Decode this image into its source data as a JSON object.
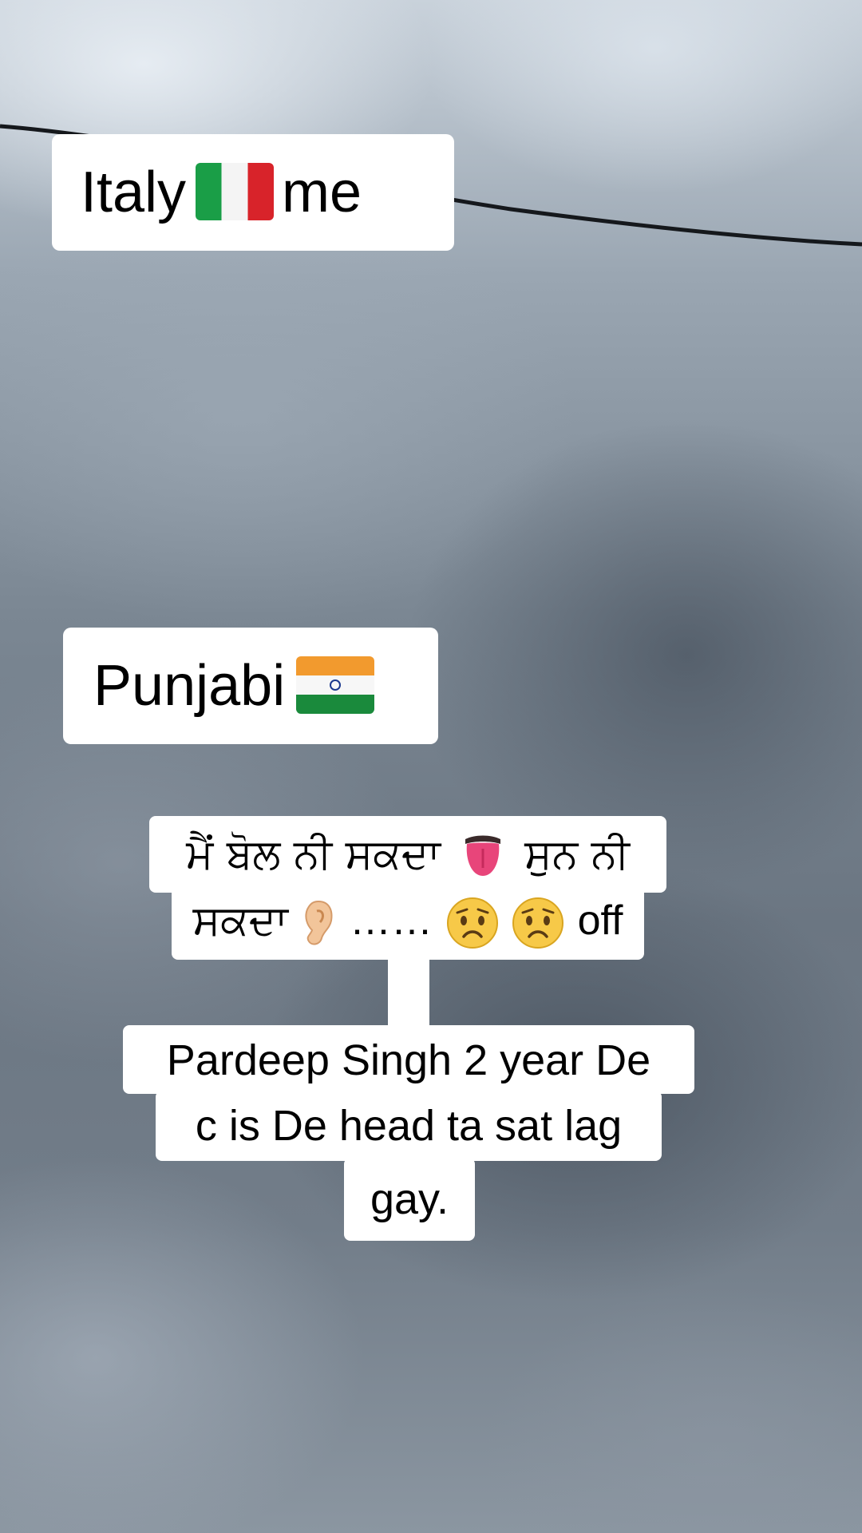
{
  "captions": {
    "italy": {
      "text_before": "Italy",
      "flag": "italy-flag",
      "text_after": "me"
    },
    "punjabi": {
      "text": "Punjabi",
      "flag": "india-flag"
    },
    "punjabi_line1": {
      "part1": "ਮੈਂ ਬੋਲ ਨੀ ਸਕਦਾ",
      "emoji": "tongue",
      "part2": "ਸੁਨ ਨੀ"
    },
    "punjabi_line2": {
      "part1": "ਸਕਦਾ",
      "emoji1": "ear",
      "dots": "……",
      "emoji2": "worried-face",
      "emoji3": "worried-face",
      "part2": "off"
    },
    "english_lines": [
      "Pardeep Singh 2 year De",
      "c is De head ta sat lag",
      "gay."
    ]
  },
  "colors": {
    "caption_bg": "#ffffff",
    "caption_text": "#000000",
    "sky_light": "#c9d2db",
    "sky_dark": "#6b7682"
  }
}
